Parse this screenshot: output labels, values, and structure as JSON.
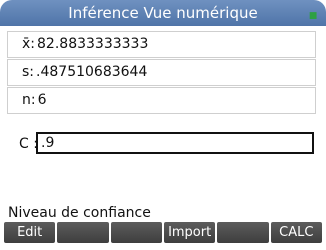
{
  "title": "Inférence Vue numérique",
  "status_icon": "battery-icon",
  "fields": [
    {
      "label": "x̄:",
      "value": "82.8833333333"
    },
    {
      "label": "s:",
      "value": ".487510683644"
    },
    {
      "label": "n:",
      "value": "6"
    }
  ],
  "confidence": {
    "label": "C :",
    "value": ".9"
  },
  "hint": "Niveau de confiance",
  "menu": [
    "Edit",
    "",
    "",
    "Import",
    "",
    "CALC"
  ]
}
